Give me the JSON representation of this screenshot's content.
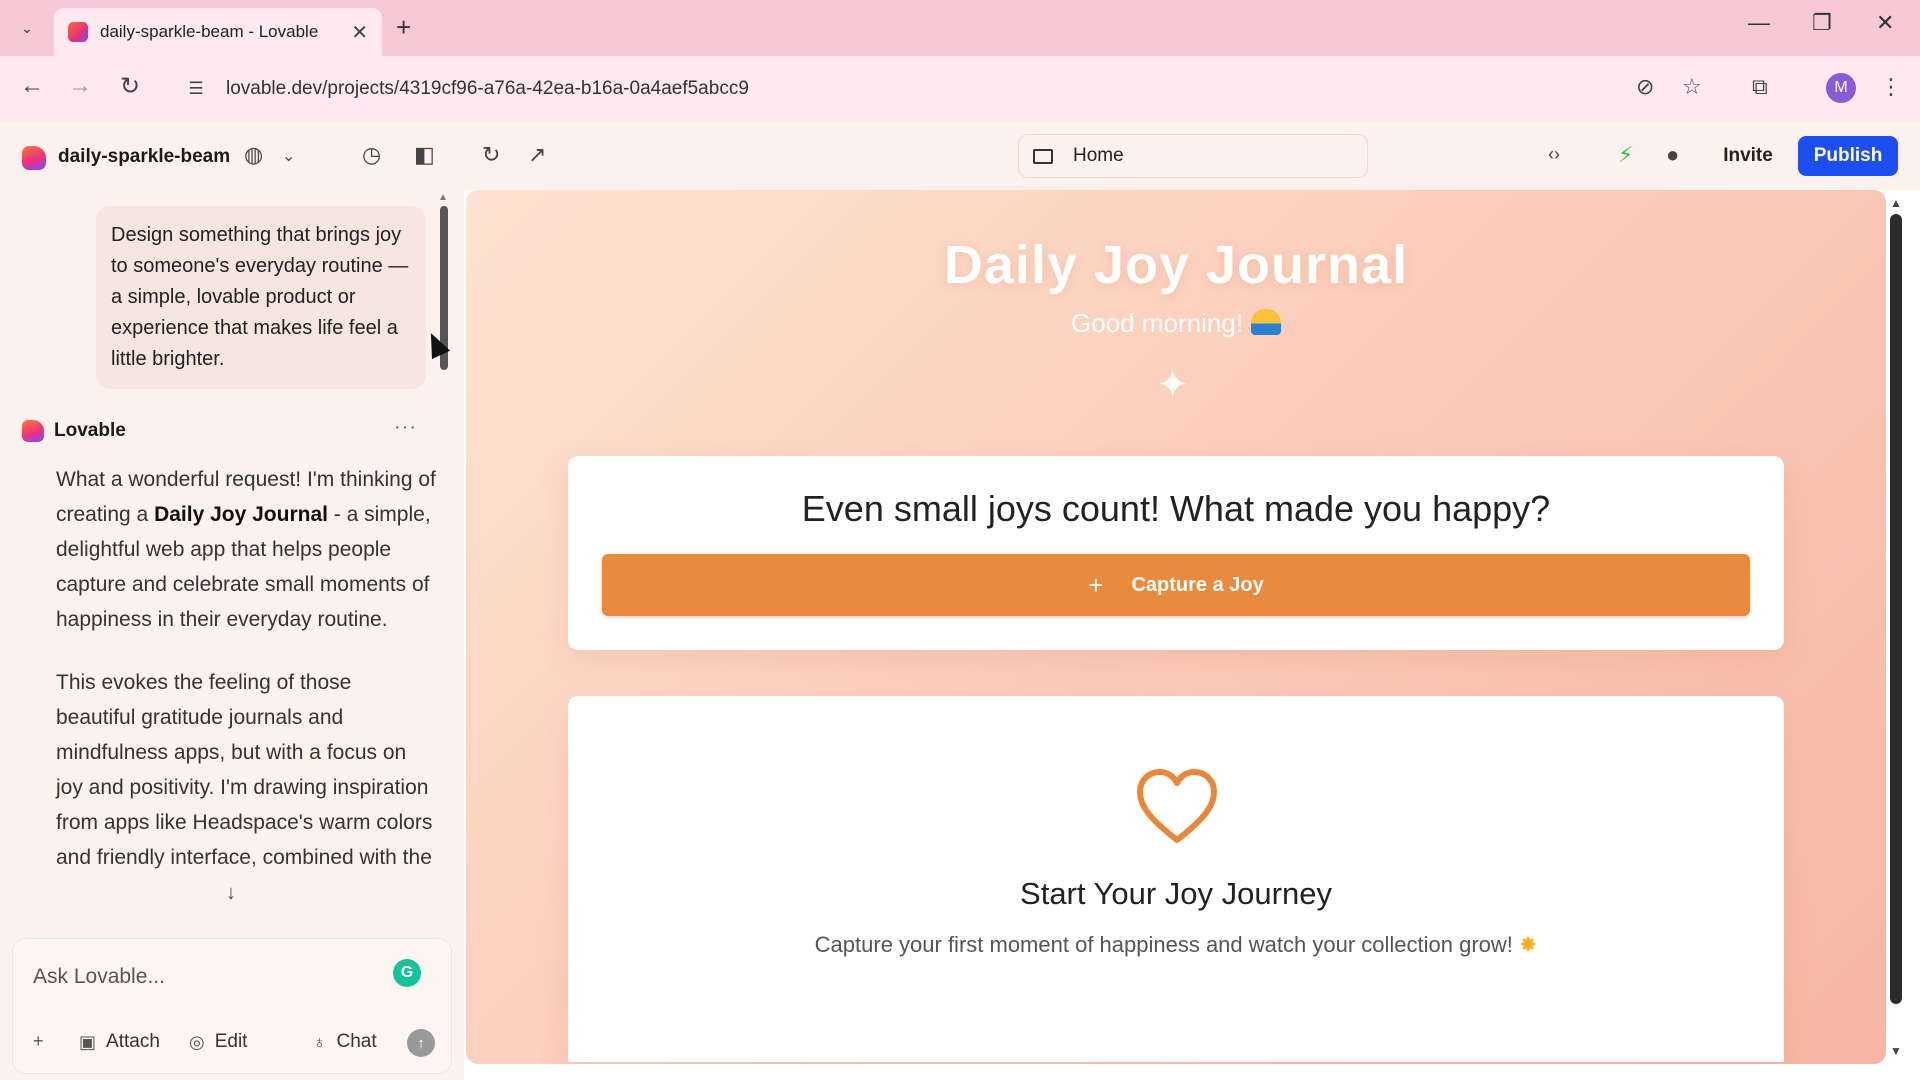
{
  "browser": {
    "tab_title": "daily-sparkle-beam - Lovable",
    "url": "lovable.dev/projects/4319cf96-a76a-42ea-b16a-0a4aef5abcc9",
    "profile_initial": "M"
  },
  "header": {
    "project_name": "daily-sparkle-beam",
    "route": "Home",
    "invite_label": "Invite",
    "publish_label": "Publish"
  },
  "chat": {
    "user_message": "Design something that brings joy to someone's everyday routine — a simple, lovable product or experience that makes life feel a little brighter.",
    "assistant_name": "Lovable",
    "assistant_p1_a": "What a wonderful request! I'm thinking of creating a ",
    "assistant_p1_bold": "Daily Joy Journal",
    "assistant_p1_b": " - a simple, delightful web app that helps people capture and celebrate small moments of happiness in their everyday routine.",
    "assistant_p2": "This evokes the feeling of those beautiful gratitude journals and mindfulness apps, but with a focus on joy and positivity. I'm drawing inspiration from apps like Headspace's warm colors and friendly interface, combined with the",
    "input_placeholder": "Ask Lovable...",
    "attach_label": "Attach",
    "edit_label": "Edit",
    "chat_label": "Chat"
  },
  "preview": {
    "app_title": "Daily Joy Journal",
    "greeting": "Good morning!",
    "prompt_question": "Even small joys count! What made you happy?",
    "capture_button": "Capture a Joy",
    "empty_title": "Start Your Joy Journey",
    "empty_subtitle": "Capture your first moment of happiness and watch your collection grow!"
  },
  "colors": {
    "accent_orange": "#ea8a3c",
    "publish_blue": "#1d4ff0",
    "tab_bar_pink": "#f7c9d7",
    "panel_bg": "#fcf1ec"
  }
}
